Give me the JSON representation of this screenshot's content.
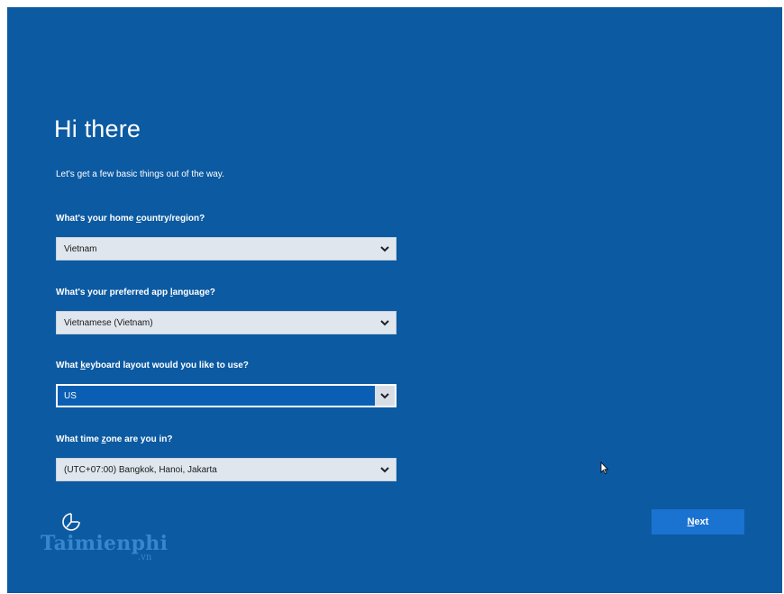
{
  "setup": {
    "title": "Hi there",
    "subtitle": "Let's get a few basic things out of the way.",
    "fields": [
      {
        "label_pre": "What's your home ",
        "label_key": "c",
        "label_post": "ountry/region?",
        "value": "Vietnam"
      },
      {
        "label_pre": "What's your preferred app ",
        "label_key": "l",
        "label_post": "anguage?",
        "value": "Vietnamese (Vietnam)"
      },
      {
        "label_pre": "What ",
        "label_key": "k",
        "label_post": "eyboard layout would you like to use?",
        "value": "US"
      },
      {
        "label_pre": "What time ",
        "label_key": "z",
        "label_post": "one are you in?",
        "value": "(UTC+07:00) Bangkok, Hanoi, Jakarta"
      }
    ],
    "next_key": "N",
    "next_rest": "ext"
  },
  "watermark": {
    "brand": "Taimienphi",
    "suffix": ".vn"
  },
  "icons": {
    "accessibility": "ease-of-access-icon",
    "dropdown": "chevron-down-icon",
    "cursor": "mouse-cursor-icon"
  },
  "colors": {
    "background": "#0c5aa2",
    "next_button": "#1a72d1",
    "dropdown_bg": "#dfe6ee",
    "focused_dropdown": "#0a5fb5"
  }
}
